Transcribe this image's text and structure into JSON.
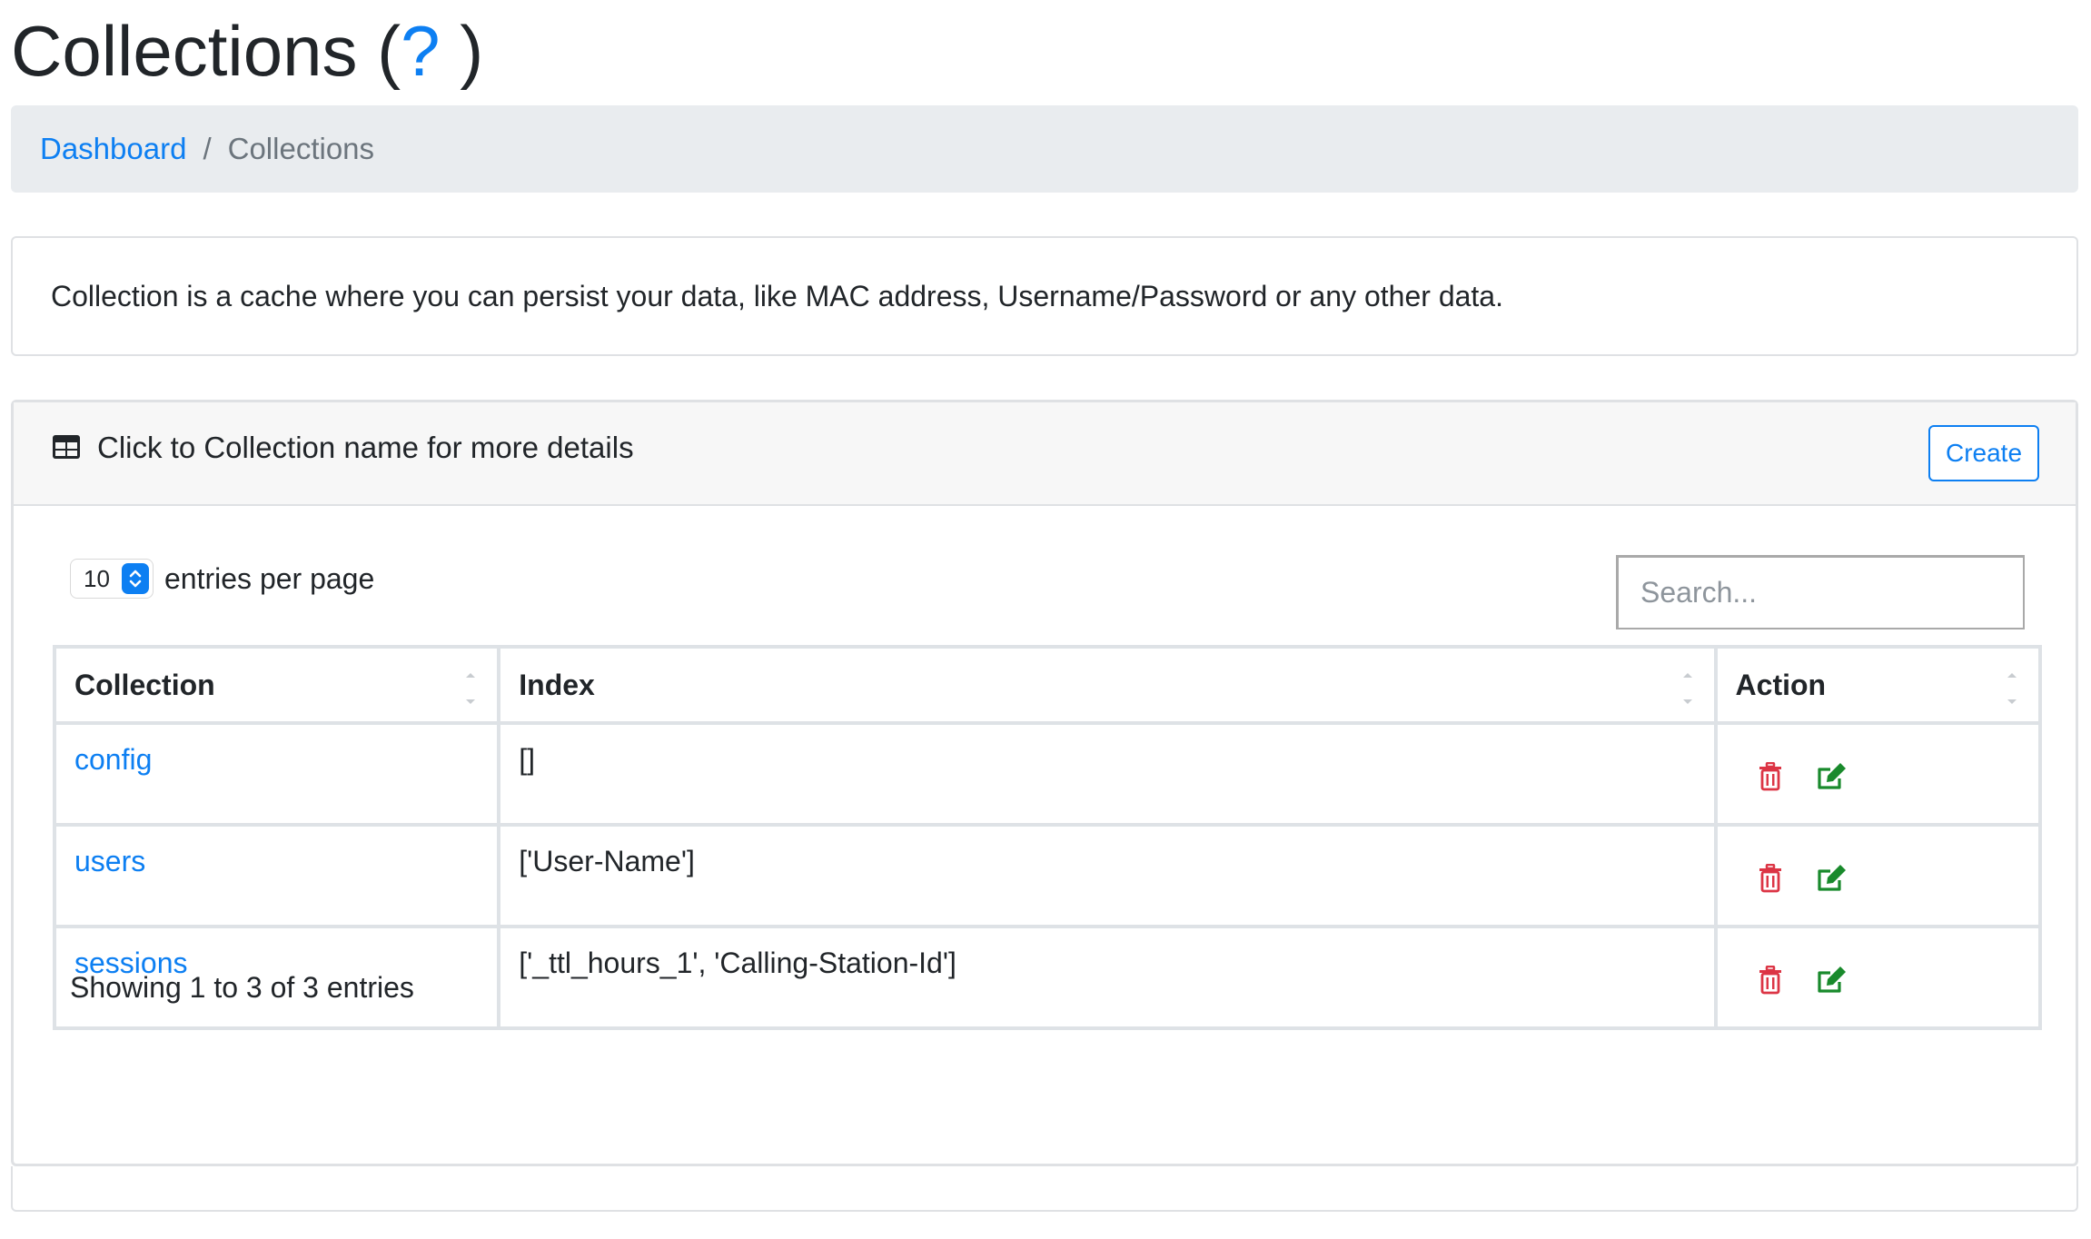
{
  "page": {
    "title": "Collections (",
    "title_help": "?",
    "title_end": " )"
  },
  "breadcrumb": {
    "link": "Dashboard",
    "separator": "/",
    "current": "Collections"
  },
  "info": {
    "text": "Collection is a cache where you can persist your data, like MAC address, Username/Password or any other data."
  },
  "card": {
    "header_icon": "table-icon",
    "header_text": "Click to Collection name for more details",
    "create_label": "Create"
  },
  "controls": {
    "entries_value": "10",
    "entries_label": "entries per page",
    "search_placeholder": "Search..."
  },
  "table": {
    "headers": [
      "Collection",
      "Index",
      "Action"
    ],
    "rows": [
      {
        "collection": "config",
        "index": "[]"
      },
      {
        "collection": "users",
        "index": "['User-Name']"
      },
      {
        "collection": "sessions",
        "index": "['_ttl_hours_1', 'Calling-Station-Id']"
      }
    ],
    "action_icons": [
      "trash-icon",
      "edit-icon"
    ]
  },
  "footer": {
    "showing": "Showing 1 to 3 of 3 entries"
  },
  "colors": {
    "link": "#0d7ff2",
    "delete": "#dc3545",
    "edit": "#198a2c",
    "breadcrumb_bg": "#e9ecef"
  }
}
